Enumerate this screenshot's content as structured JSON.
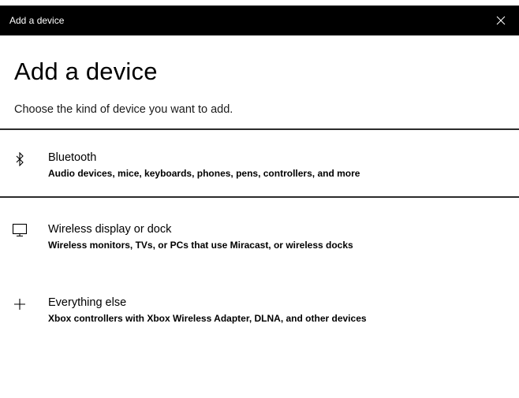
{
  "window": {
    "title": "Add a device"
  },
  "page": {
    "heading": "Add a device",
    "subheading": "Choose the kind of device you want to add."
  },
  "options": [
    {
      "label": "Bluetooth",
      "description": "Audio devices, mice, keyboards, phones, pens, controllers, and more",
      "icon": "bluetooth-icon"
    },
    {
      "label": "Wireless display or dock",
      "description": "Wireless monitors, TVs, or PCs that use Miracast, or wireless docks",
      "icon": "monitor-icon"
    },
    {
      "label": "Everything else",
      "description": "Xbox controllers with Xbox Wireless Adapter, DLNA, and other devices",
      "icon": "plus-icon"
    }
  ],
  "colors": {
    "titlebar_bg": "#000000",
    "titlebar_text": "#ffffff",
    "selection_border": "#2b2b2b"
  }
}
